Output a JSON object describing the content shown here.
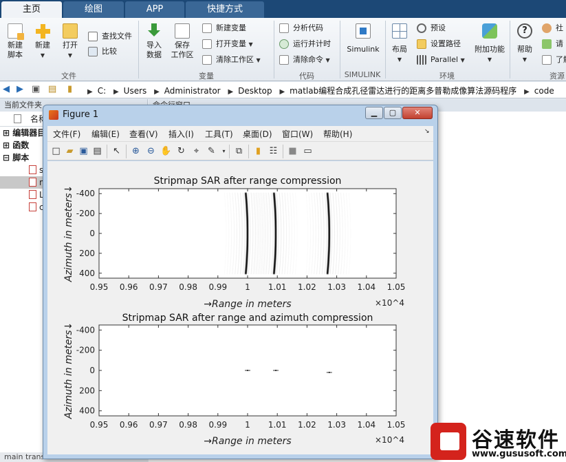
{
  "tabs": [
    {
      "label": "主页",
      "active": true
    },
    {
      "label": "绘图",
      "active": false
    },
    {
      "label": "APP",
      "active": false
    },
    {
      "label": "快捷方式",
      "active": false
    }
  ],
  "ribbon": {
    "file": {
      "new_script": "新建\n脚本",
      "new": "新建",
      "open": "打开",
      "find_files": "查找文件",
      "compare": "比较",
      "group": "文件"
    },
    "variable": {
      "import_data": "导入\n数据",
      "save_workspace": "保存\n工作区",
      "new_variable": "新建变量",
      "open_variable": "打开变量",
      "clear_workspace": "清除工作区",
      "group": "变量"
    },
    "code": {
      "analyze_code": "分析代码",
      "run_and_time": "运行并计时",
      "clear_commands": "清除命令",
      "group": "代码"
    },
    "simulink": {
      "label": "Simulink",
      "group": "SIMULINK"
    },
    "environment": {
      "layout": "布局",
      "preferences": "预设",
      "set_path": "设置路径",
      "parallel": "Parallel",
      "addons": "附加功能",
      "group": "环境"
    },
    "resources": {
      "help": "帮助",
      "community": "社",
      "request": "请",
      "learn": "了解",
      "group": "资源"
    }
  },
  "address": {
    "crumbs": [
      "C:",
      "Users",
      "Administrator",
      "Desktop",
      "matlab编程合成孔径雷达进行的距离多普勒成像算法源码程序",
      "code"
    ]
  },
  "left_panel": {
    "title": "当前文件夹",
    "column_header": "名称",
    "tree": [
      {
        "label": "编辑器目",
        "bold": true
      },
      {
        "label": "函数",
        "bold": true
      },
      {
        "label": "脚本",
        "bold": true
      }
    ],
    "files": [
      "s",
      "m",
      "L",
      "c"
    ],
    "bottom": "main translational motion co..."
  },
  "command_window": {
    "title": "命令行窗口"
  },
  "figure": {
    "title": "Figure 1",
    "menus": [
      "文件(F)",
      "编辑(E)",
      "查看(V)",
      "插入(I)",
      "工具(T)",
      "桌面(D)",
      "窗口(W)",
      "帮助(H)"
    ]
  },
  "chart_data": [
    {
      "type": "heatmap",
      "title": "Stripmap SAR after range compression",
      "xlabel": "→Range in meters",
      "ylabel": "Azimuth in meters↓",
      "x_ticks": [
        0.95,
        0.96,
        0.97,
        0.98,
        0.99,
        1,
        1.01,
        1.02,
        1.03,
        1.04,
        1.05
      ],
      "x_exponent": "×10^4",
      "xlim": [
        0.95,
        1.05
      ],
      "y_ticks": [
        -400,
        -200,
        0,
        200,
        400
      ],
      "ylim": [
        -450,
        450
      ],
      "y_reversed": true,
      "colormap": "gray-inverted",
      "features": [
        {
          "kind": "range-migration curve",
          "x_center": 1.0,
          "x_curvature": 0.0006
        },
        {
          "kind": "range-migration curve",
          "x_center": 1.0095,
          "x_curvature": 0.0006
        },
        {
          "kind": "range-migration curve",
          "x_center": 1.0275,
          "x_curvature": 0.0006
        }
      ]
    },
    {
      "type": "heatmap",
      "title": "Stripmap SAR after range and azimuth compression",
      "xlabel": "→Range in meters",
      "ylabel": "Azimuth in meters↓",
      "x_ticks": [
        0.95,
        0.96,
        0.97,
        0.98,
        0.99,
        1,
        1.01,
        1.02,
        1.03,
        1.04,
        1.05
      ],
      "x_exponent": "×10^4",
      "xlim": [
        0.95,
        1.05
      ],
      "y_ticks": [
        -400,
        -200,
        0,
        200,
        400
      ],
      "ylim": [
        -450,
        450
      ],
      "y_reversed": true,
      "colormap": "gray-inverted",
      "features": [
        {
          "kind": "point target",
          "x": 1.0,
          "y": 0
        },
        {
          "kind": "point target",
          "x": 1.0095,
          "y": 0
        },
        {
          "kind": "point target",
          "x": 1.0275,
          "y": 20
        }
      ]
    }
  ],
  "watermark": {
    "text": "谷速软件",
    "url": "www.gususoft.com"
  },
  "colors": {
    "tabbar": "#1c4876",
    "ribbon": "#eef2f6",
    "figure_frame": "#b9d1ea",
    "figure_bg": "#f0f0f0",
    "brand_red": "#d4231c"
  }
}
